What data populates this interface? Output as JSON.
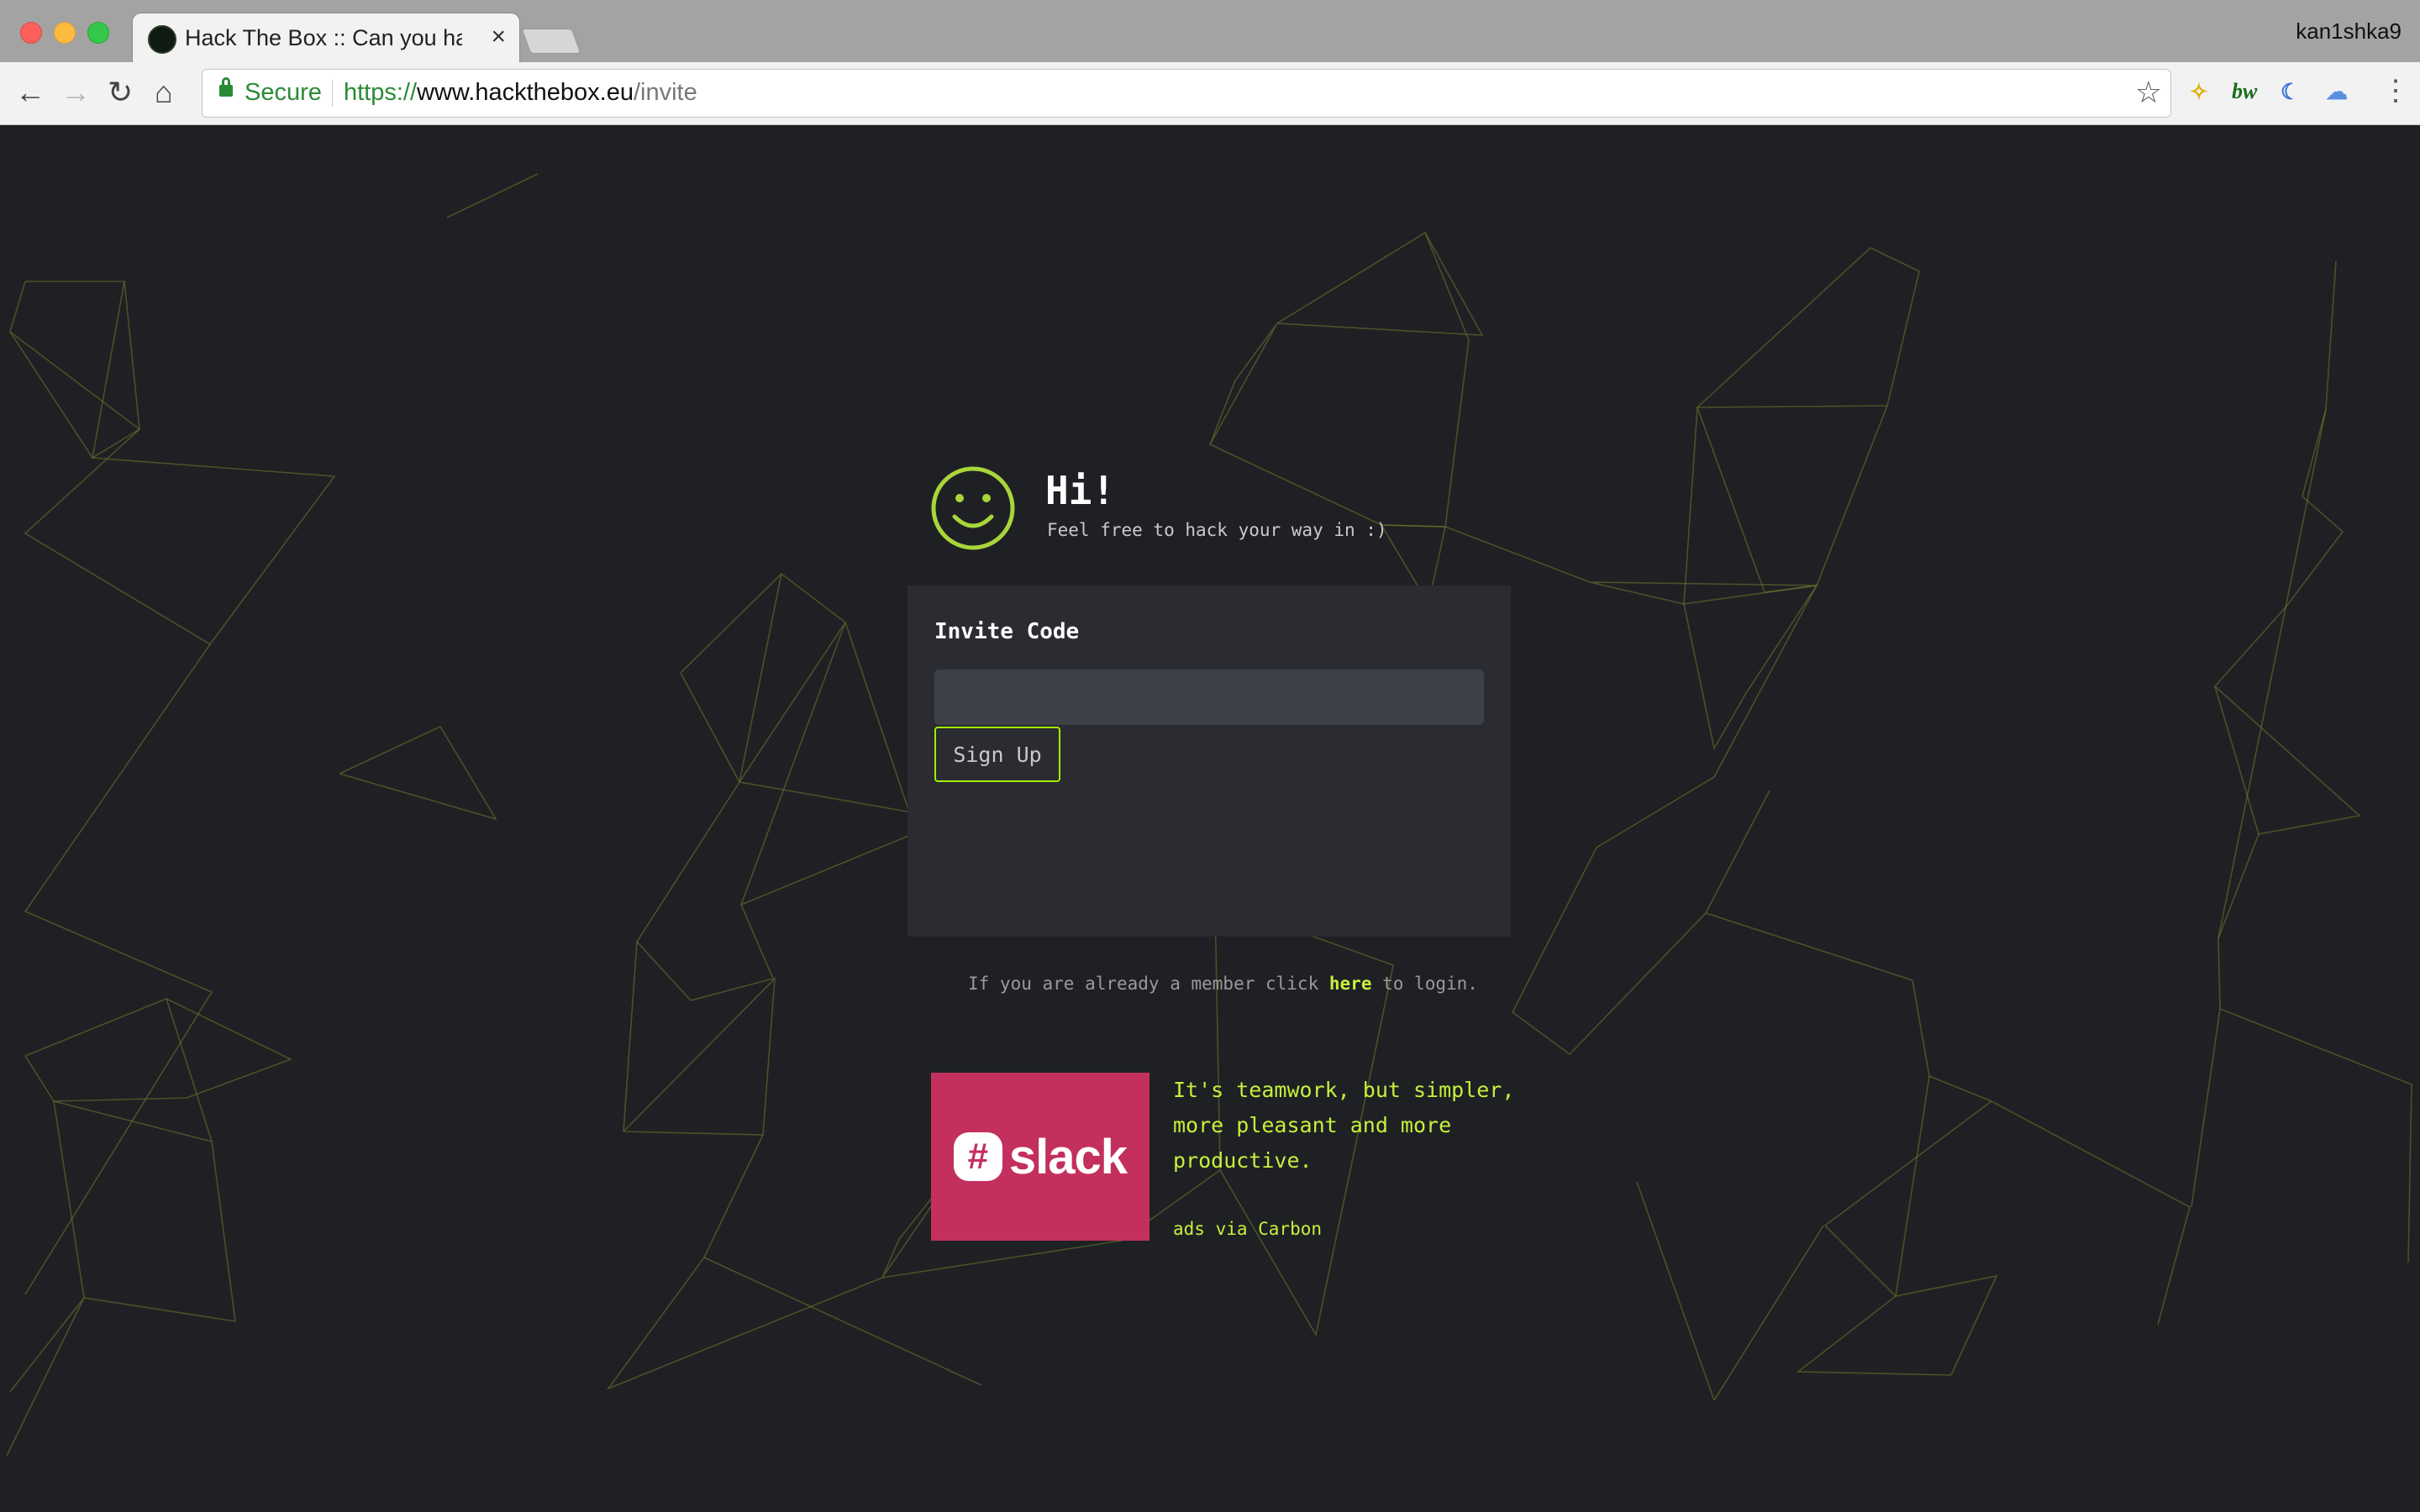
{
  "browser": {
    "tab_title": "Hack The Box :: Can you hack",
    "tab_close": "×",
    "profile_name": "kan1shka9",
    "secure_label": "Secure",
    "url_scheme": "https://",
    "url_host": "www.hackthebox.eu",
    "url_path": "/invite",
    "icons": [
      "back-arrow-icon",
      "forward-arrow-icon",
      "reload-icon",
      "home-icon",
      "lock-icon",
      "star-icon",
      "extension-icon",
      "bw-extension-icon",
      "moon-extension-icon",
      "cloud-extension-icon",
      "menu-dots-icon"
    ]
  },
  "page": {
    "greeting": "Hi!",
    "tagline": "Feel free to hack your way in :)",
    "form": {
      "label": "Invite Code",
      "input_value": "",
      "submit_label": "Sign Up"
    },
    "login_prefix": "If you are already a member click",
    "login_link": "here",
    "login_suffix": "to login.",
    "ad": {
      "brand": "slack",
      "text": "It's teamwork, but simpler, more pleasant and more productive.",
      "via": "ads via Carbon"
    },
    "colors": {
      "background": "#1f2024",
      "accent": "#9fef00",
      "card": "#2a2c31",
      "ad_background": "#c3305d"
    }
  }
}
